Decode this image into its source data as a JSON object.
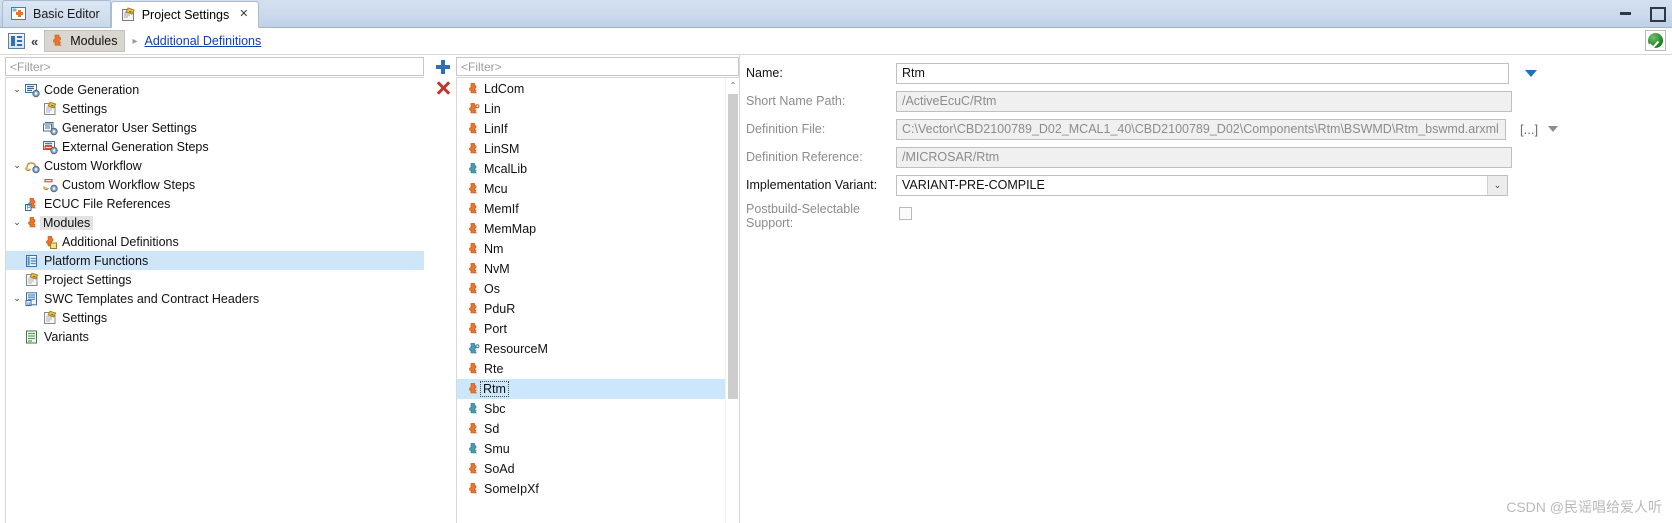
{
  "window": {
    "minimize_label": "Minimize",
    "maximize_label": "Maximize"
  },
  "tabs": [
    {
      "label": "Basic Editor",
      "icon": "puzzle-editor-icon",
      "active": false,
      "closable": false
    },
    {
      "label": "Project Settings",
      "icon": "settings-page-icon",
      "active": true,
      "closable": true,
      "close_glyph": "✕"
    }
  ],
  "breadcrumb": {
    "home_icon": "home-view-icon",
    "collapse_glyph": "«",
    "node": {
      "label": "Modules",
      "icon": "puzzle-orange-icon"
    },
    "separator_glyph": "▸",
    "link": "Additional Definitions",
    "status_icon": "green-check-badge"
  },
  "left_panel": {
    "filter_placeholder": "<Filter>",
    "tree": [
      {
        "label": "Code Generation",
        "indent": 0,
        "twist": "⌄",
        "icon": "codegen-icon",
        "state": ""
      },
      {
        "label": "Settings",
        "indent": 1,
        "twist": "",
        "icon": "settings-page-icon",
        "state": ""
      },
      {
        "label": "Generator User Settings",
        "indent": 1,
        "twist": "",
        "icon": "generator-icon",
        "state": ""
      },
      {
        "label": "External Generation Steps",
        "indent": 1,
        "twist": "",
        "icon": "ext-gen-icon",
        "state": ""
      },
      {
        "label": "Custom Workflow",
        "indent": 0,
        "twist": "⌄",
        "icon": "workflow-icon",
        "state": ""
      },
      {
        "label": "Custom Workflow Steps",
        "indent": 1,
        "twist": "",
        "icon": "workflow-step-icon",
        "state": ""
      },
      {
        "label": "ECUC File References",
        "indent": 0,
        "twist": "",
        "icon": "ecuc-file-icon",
        "state": ""
      },
      {
        "label": "Modules",
        "indent": 0,
        "twist": "⌄",
        "icon": "puzzle-orange-icon",
        "state": "sel-gray"
      },
      {
        "label": "Additional Definitions",
        "indent": 1,
        "twist": "",
        "icon": "puzzle-add-icon",
        "state": ""
      },
      {
        "label": "Platform Functions",
        "indent": 0,
        "twist": "",
        "icon": "platform-icon",
        "state": "sel-blue"
      },
      {
        "label": "Project Settings",
        "indent": 0,
        "twist": "",
        "icon": "settings-page-icon",
        "state": ""
      },
      {
        "label": "SWC Templates and Contract Headers",
        "indent": 0,
        "twist": "⌄",
        "icon": "swc-template-icon",
        "state": ""
      },
      {
        "label": "Settings",
        "indent": 1,
        "twist": "",
        "icon": "settings-page-icon",
        "state": ""
      },
      {
        "label": "Variants",
        "indent": 0,
        "twist": "",
        "icon": "variants-icon",
        "state": ""
      }
    ]
  },
  "tools": {
    "add_label": "Add",
    "remove_label": "Remove"
  },
  "module_panel": {
    "filter_placeholder": "<Filter>",
    "scroll_up_glyph": "⌃",
    "modules": [
      {
        "label": "LdCom",
        "icon": "puzzle-orange-icon",
        "selected": false
      },
      {
        "label": "Lin",
        "icon": "puzzle-orange-open-icon",
        "selected": false
      },
      {
        "label": "LinIf",
        "icon": "puzzle-orange-icon",
        "selected": false
      },
      {
        "label": "LinSM",
        "icon": "puzzle-orange-icon",
        "selected": false
      },
      {
        "label": "McalLib",
        "icon": "puzzle-teal-icon",
        "selected": false
      },
      {
        "label": "Mcu",
        "icon": "puzzle-orange-icon",
        "selected": false
      },
      {
        "label": "MemIf",
        "icon": "puzzle-orange-icon",
        "selected": false
      },
      {
        "label": "MemMap",
        "icon": "puzzle-orange-icon",
        "selected": false
      },
      {
        "label": "Nm",
        "icon": "puzzle-orange-icon",
        "selected": false
      },
      {
        "label": "NvM",
        "icon": "puzzle-orange-icon",
        "selected": false
      },
      {
        "label": "Os",
        "icon": "puzzle-orange-icon",
        "selected": false
      },
      {
        "label": "PduR",
        "icon": "puzzle-orange-icon",
        "selected": false
      },
      {
        "label": "Port",
        "icon": "puzzle-orange-icon",
        "selected": false
      },
      {
        "label": "ResourceM",
        "icon": "puzzle-teal-open-icon",
        "selected": false
      },
      {
        "label": "Rte",
        "icon": "puzzle-orange-icon",
        "selected": false
      },
      {
        "label": "Rtm",
        "icon": "puzzle-orange-icon",
        "selected": true
      },
      {
        "label": "Sbc",
        "icon": "puzzle-teal-icon",
        "selected": false
      },
      {
        "label": "Sd",
        "icon": "puzzle-orange-icon",
        "selected": false
      },
      {
        "label": "Smu",
        "icon": "puzzle-teal-icon",
        "selected": false
      },
      {
        "label": "SoAd",
        "icon": "puzzle-orange-icon",
        "selected": false
      },
      {
        "label": "SomeIpXf",
        "icon": "puzzle-orange-icon",
        "selected": false
      }
    ]
  },
  "detail_form": {
    "name": {
      "label": "Name:",
      "value": "Rtm",
      "readonly": false,
      "caret_icon": "blue-dropdown-caret-icon"
    },
    "short_name_path": {
      "label": "Short Name Path:",
      "value": "/ActiveEcuC/Rtm",
      "readonly": true
    },
    "definition_file": {
      "label": "Definition File:",
      "value": "C:\\Vector\\CBD2100789_D02_MCAL1_40\\CBD2100789_D02\\Components\\Rtm\\BSWMD\\Rtm_bswmd.arxml",
      "readonly": true,
      "browse_label": "[...]",
      "caret_icon": "gray-dropdown-caret-icon"
    },
    "definition_reference": {
      "label": "Definition Reference:",
      "value": "/MICROSAR/Rtm",
      "readonly": true
    },
    "implementation_variant": {
      "label": "Implementation Variant:",
      "value": "VARIANT-PRE-COMPILE",
      "readonly": false,
      "arrow_glyph": "⌄"
    },
    "postbuild_selectable": {
      "label_line1": "Postbuild-Selectable",
      "label_line2": "Support:",
      "checked": false
    }
  },
  "watermark": "CSDN @民谣唱给爱人听"
}
